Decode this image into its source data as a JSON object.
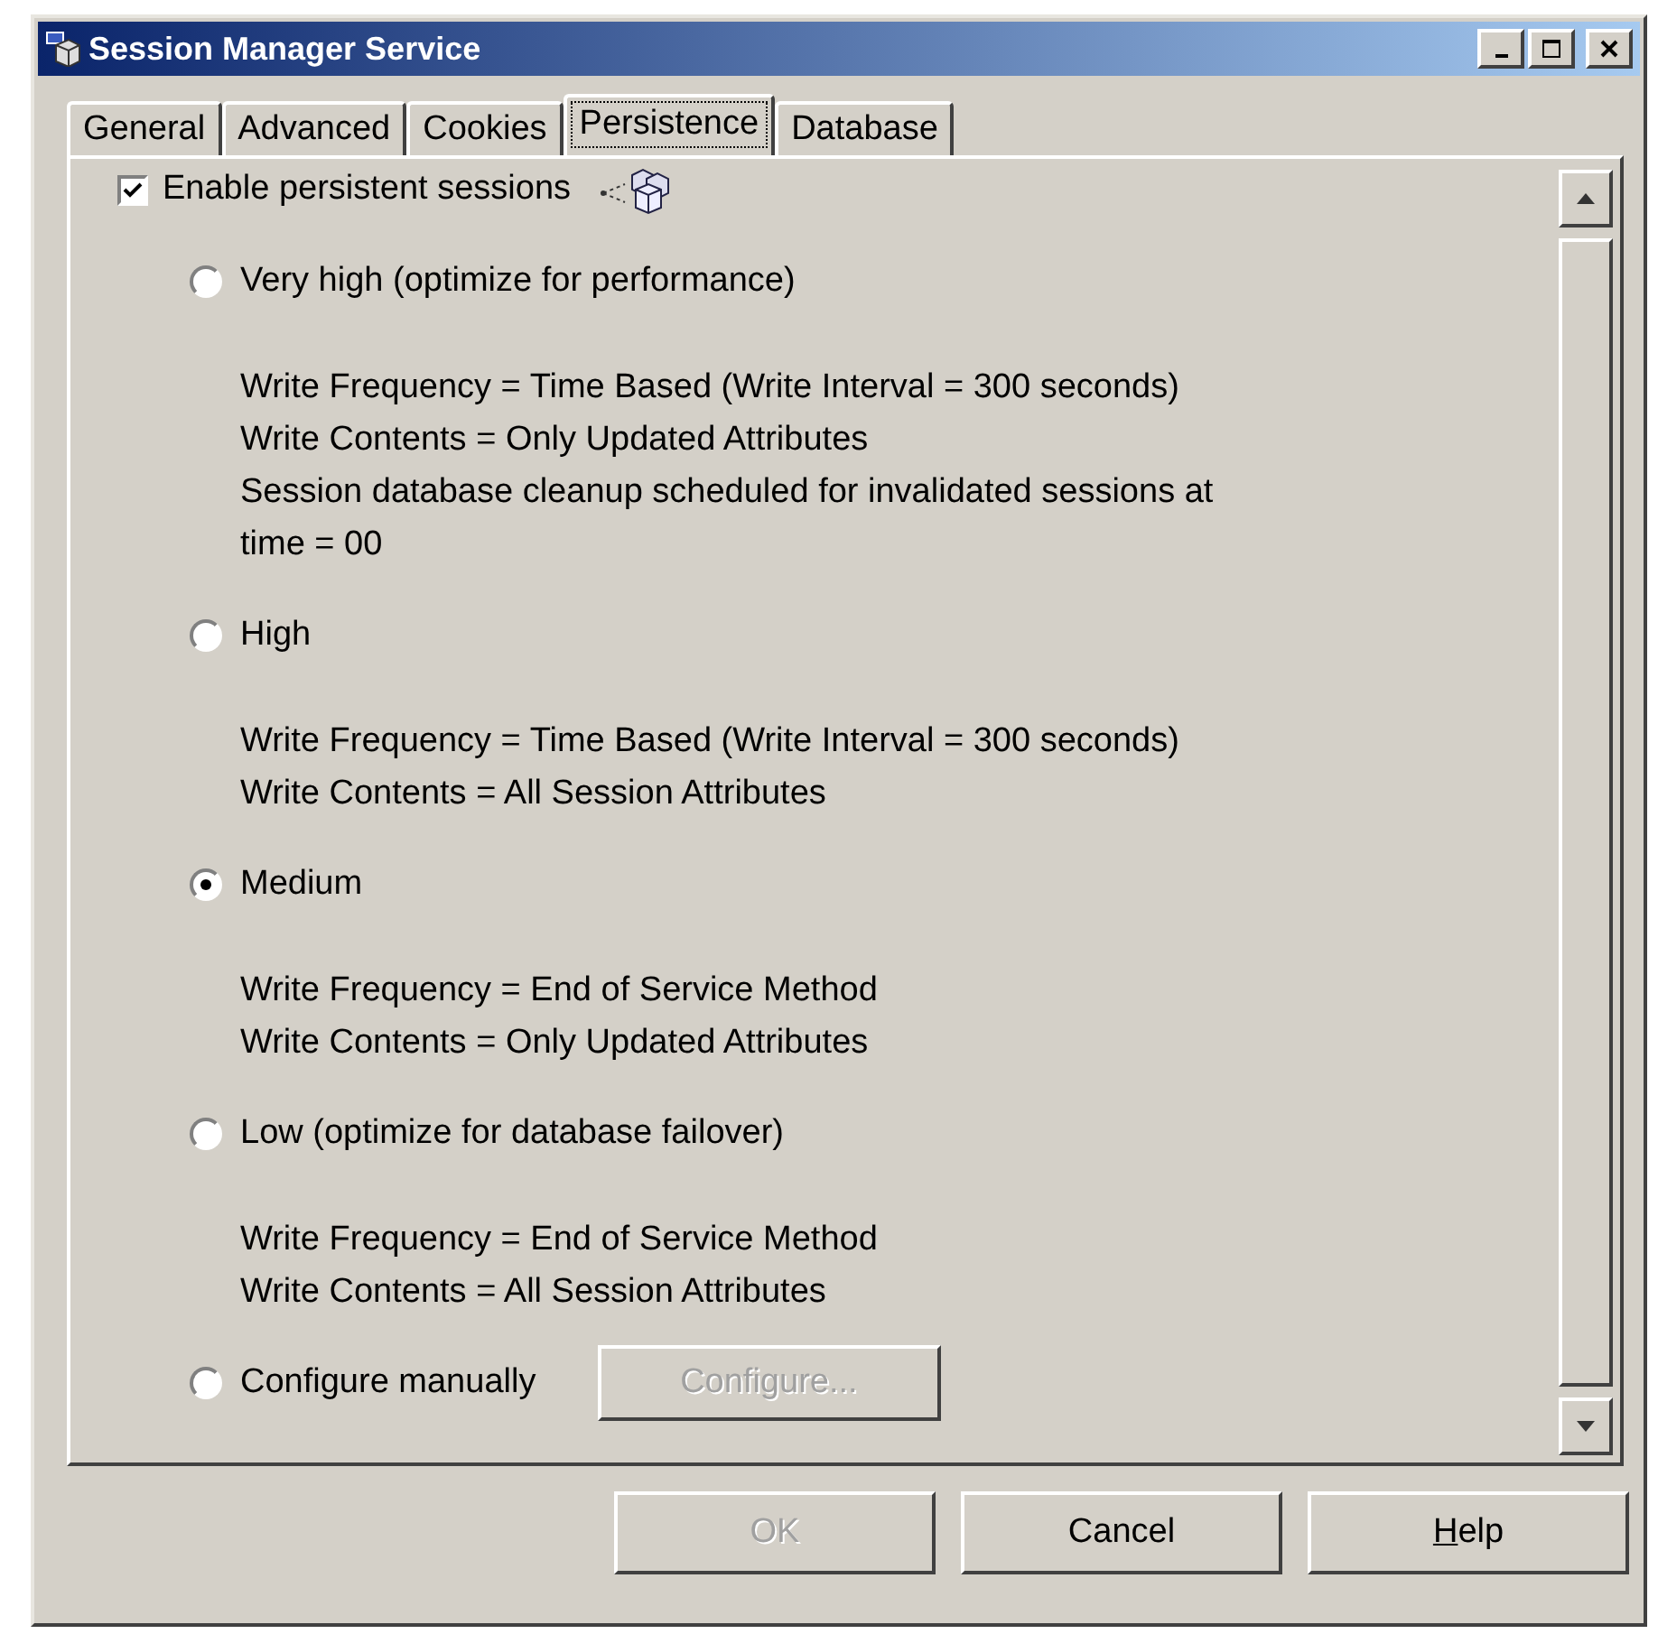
{
  "window": {
    "title": "Session Manager Service"
  },
  "tabs": [
    {
      "label": "General",
      "selected": false
    },
    {
      "label": "Advanced",
      "selected": false
    },
    {
      "label": "Cookies",
      "selected": false
    },
    {
      "label": "Persistence",
      "selected": true
    },
    {
      "label": "Database",
      "selected": false
    }
  ],
  "enable_checkbox": {
    "label": "Enable persistent sessions",
    "checked": true
  },
  "options": [
    {
      "label": "Very high (optimize for performance)",
      "selected": false,
      "details": [
        "Write Frequency = Time Based (Write Interval = 300 seconds)",
        "Write Contents = Only Updated Attributes",
        "Session database cleanup scheduled for invalidated sessions at time = 00"
      ]
    },
    {
      "label": "High",
      "selected": false,
      "details": [
        "Write Frequency = Time Based (Write Interval = 300 seconds)",
        "Write Contents = All Session Attributes"
      ]
    },
    {
      "label": "Medium",
      "selected": true,
      "details": [
        "Write Frequency = End of Service Method",
        "Write Contents = Only Updated Attributes"
      ]
    },
    {
      "label": "Low (optimize for database failover)",
      "selected": false,
      "details": [
        "Write Frequency = End of Service Method",
        "Write Contents = All Session Attributes"
      ]
    },
    {
      "label": "Configure manually",
      "selected": false,
      "button": {
        "label": "Configure...",
        "disabled": true
      }
    }
  ],
  "buttons": [
    {
      "label": "OK",
      "disabled": true,
      "underline_first": false
    },
    {
      "label": "Cancel",
      "disabled": false,
      "underline_first": false
    },
    {
      "label": "Help",
      "disabled": false,
      "underline_first": true
    }
  ]
}
